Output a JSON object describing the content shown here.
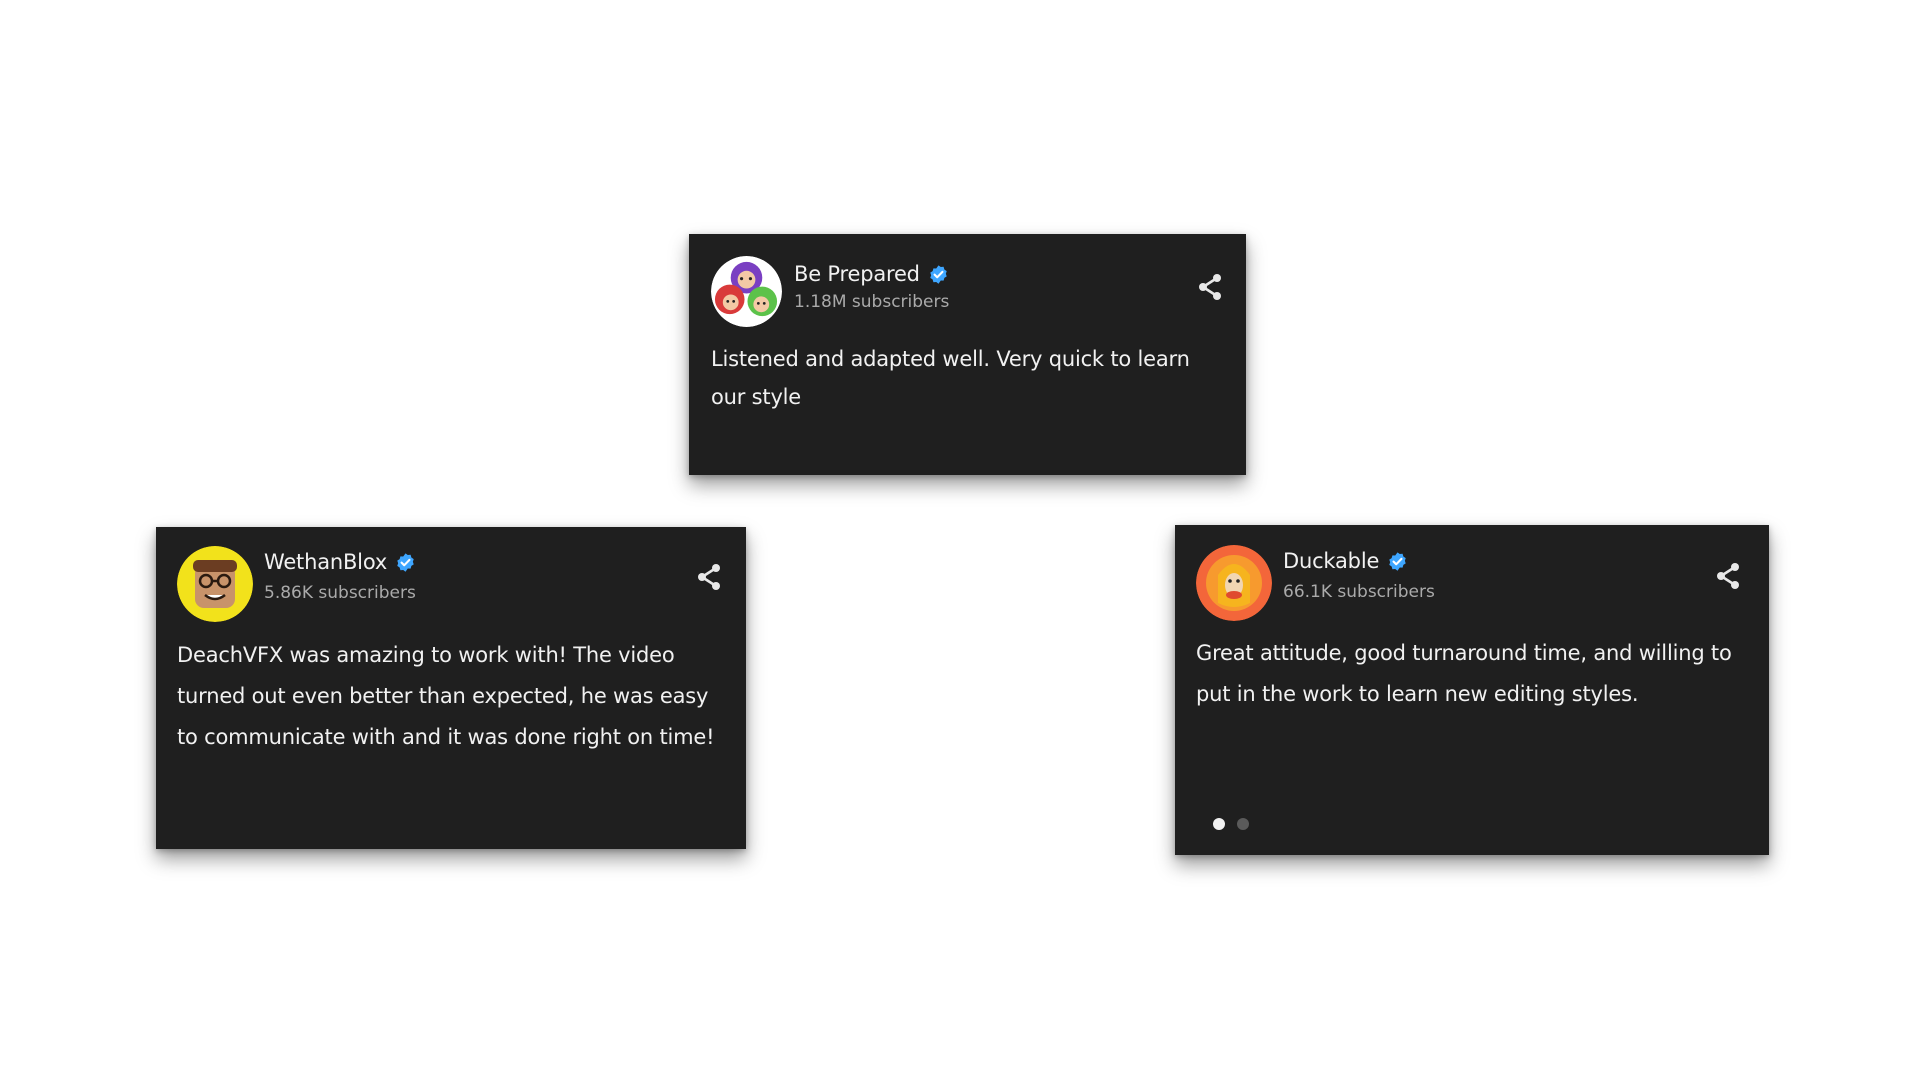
{
  "colors": {
    "card_background": "#1f1f1f",
    "text_primary": "#f1f1f1",
    "text_secondary": "#aaaaaa",
    "verified_badge": "#3ea6ff",
    "page_background": "#ffffff"
  },
  "cards": [
    {
      "channel_name": "Be Prepared",
      "subscribers": "1.18M subscribers",
      "testimonial": "Listened and adapted well. Very quick to learn our style",
      "verified_icon": "verified-check-icon",
      "share_icon": "share-icon"
    },
    {
      "channel_name": "WethanBlox",
      "subscribers": "5.86K subscribers",
      "testimonial": "DeachVFX was amazing to work with! The video turned out even better than expected, he was easy to communicate with and it was done right on time!",
      "verified_icon": "verified-check-icon",
      "share_icon": "share-icon"
    },
    {
      "channel_name": "Duckable",
      "subscribers": "66.1K subscribers",
      "testimonial": "Great attitude, good turnaround time, and willing to put in the work to learn new editing styles.",
      "verified_icon": "verified-check-icon",
      "share_icon": "share-icon",
      "pagination": {
        "total": 2,
        "active": 1
      }
    }
  ]
}
